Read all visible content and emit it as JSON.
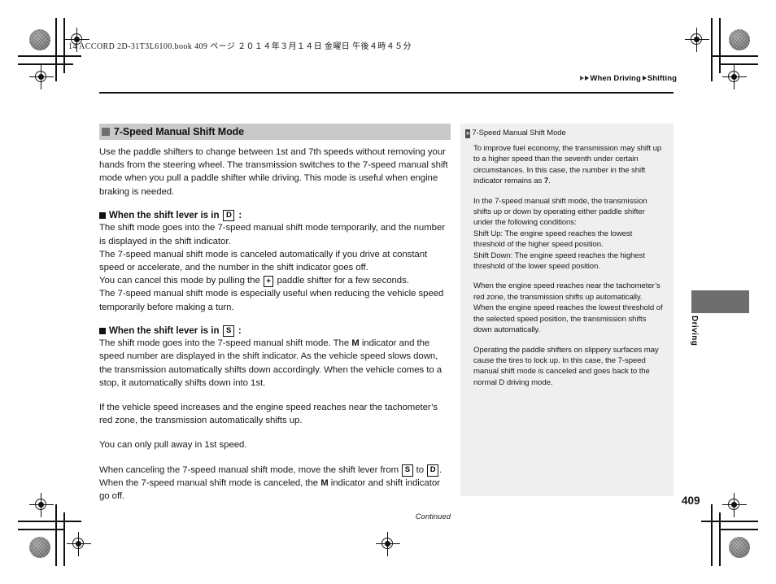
{
  "document": {
    "slug_line": "14 ACCORD 2D-31T3L6100.book   409 ページ   ２０１４年３月１４日   金曜日   午後４時４５分",
    "folio": "409",
    "thumb_tab_label": "Driving"
  },
  "running_head": {
    "part1": "When Driving",
    "part2": "Shifting"
  },
  "section": {
    "title": "7-Speed Manual Shift Mode",
    "intro": "Use the paddle shifters to change between 1st and 7th speeds without removing your hands from the steering wheel. The transmission switches to the 7-speed manual shift mode when you pull a paddle shifter while driving. This mode is useful when engine braking is needed.",
    "sub1": {
      "heading_pre": "When the shift lever is in",
      "heading_key": "D",
      "heading_post": ":",
      "p1": "The shift mode goes into the 7-speed manual shift mode temporarily, and the number is displayed in the shift indicator.",
      "p2": "The 7-speed manual shift mode is canceled automatically if you drive at constant speed or accelerate, and the number in the shift indicator goes off.",
      "p3_pre": "You can cancel this mode by pulling the",
      "p3_key": "+",
      "p3_post": "paddle shifter for a few seconds.",
      "p4": "The 7-speed manual shift mode is especially useful when reducing the vehicle speed temporarily before making a turn."
    },
    "sub2": {
      "heading_pre": "When the shift lever is in",
      "heading_key": "S",
      "heading_post": ":",
      "p1_a": "The shift mode goes into the 7-speed manual shift mode. The",
      "p1_key": "M",
      "p1_b": "indicator and the speed number are displayed in the shift indicator. As the vehicle speed slows down, the transmission automatically shifts down accordingly. When the vehicle comes to a stop, it automatically shifts down into 1st."
    },
    "p_tach": "If the vehicle speed increases and the engine speed reaches near the tachometer’s red zone, the transmission automatically shifts up.",
    "p_pullaway": "You can only pull away in 1st speed.",
    "p_cancel_a": "When canceling the 7-speed manual shift mode, move the shift lever from",
    "p_cancel_key1": "S",
    "p_cancel_b": "to",
    "p_cancel_key2": "D",
    "p_cancel_c": ". When the 7-speed manual shift mode is canceled, the",
    "p_cancel_key3": "M",
    "p_cancel_d": "indicator and shift indicator go off.",
    "continued": "Continued"
  },
  "sidenote": {
    "icon": "double-chevron-right",
    "title": "7-Speed Manual Shift Mode",
    "p1_a": "To improve fuel economy, the transmission may shift up to a higher speed than the seventh under certain circumstances. In this case, the number in the shift indicator remains as",
    "p1_bold": "7",
    "p1_b": ".",
    "p2": "In the 7-speed manual shift mode, the transmission shifts up or down by operating either paddle shifter under the following conditions:",
    "p3": "Shift Up: The engine speed reaches the lowest threshold of the higher speed position.",
    "p4": "Shift Down: The engine speed reaches the highest threshold of the lower speed position.",
    "p5": "When the engine speed reaches near the tachometer’s red zone, the transmission shifts up automatically.",
    "p6": "When the engine speed reaches the lowest threshold of the selected speed position, the transmission shifts down automatically.",
    "p7": "Operating the paddle shifters on slippery surfaces may cause the tires to lock up. In this case, the 7-speed manual shift mode is canceled and goes back to the normal D driving mode."
  },
  "colors": {
    "section_bar": "#c9c9c9",
    "section_bullet": "#6e6e6e",
    "sidepanel_bg": "#efefef",
    "thumb_tab": "#6e6e6e",
    "text": "#1a1a1a"
  }
}
